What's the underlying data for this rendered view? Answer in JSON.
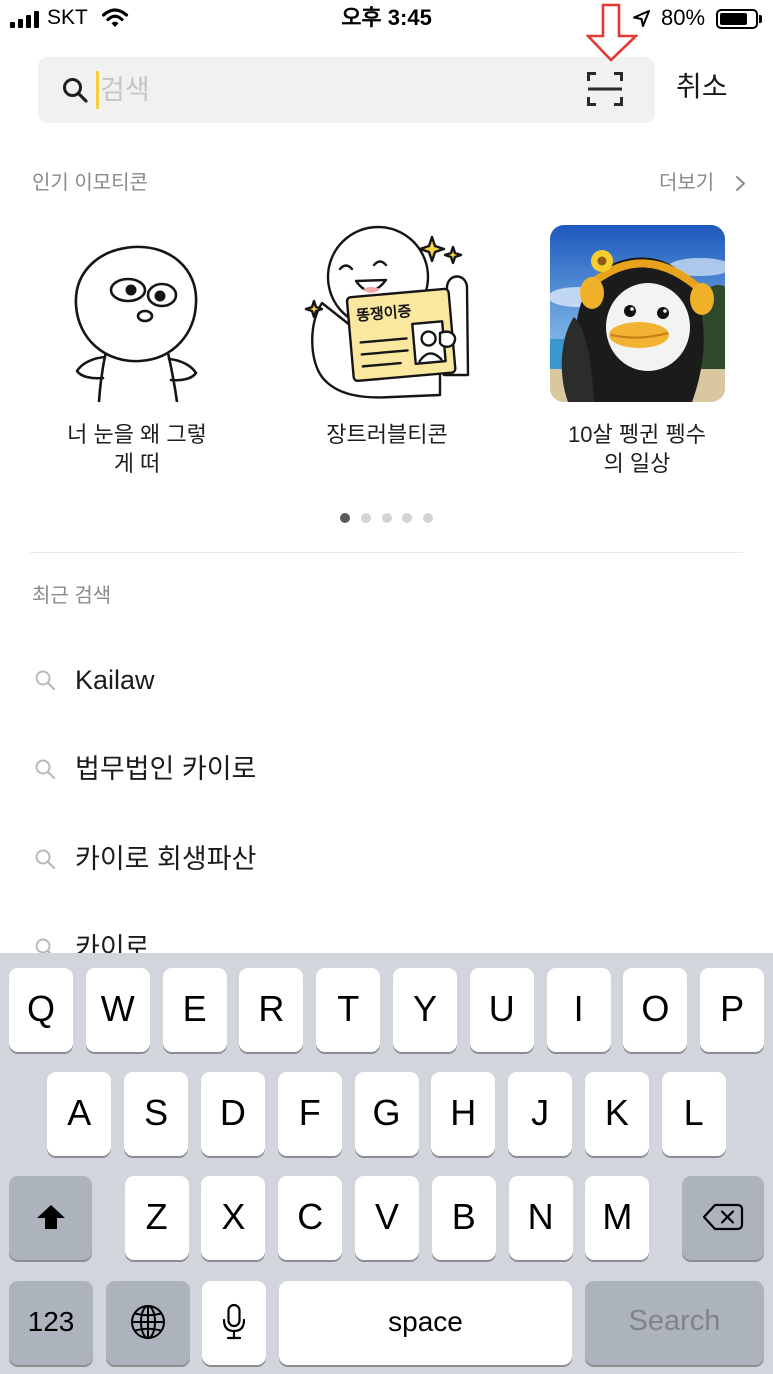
{
  "status_bar": {
    "carrier": "SKT",
    "time": "오후 3:45",
    "battery_percent": "80%",
    "battery_level": 0.8
  },
  "search": {
    "placeholder": "검색",
    "value": "",
    "cancel_label": "취소"
  },
  "popular_emoticons": {
    "title": "인기 이모티콘",
    "more_label": "더보기",
    "items": [
      {
        "title": "너 눈을 왜 그렇\n게 떠"
      },
      {
        "title": "장트러블티콘",
        "card_text": "똥쟁이증"
      },
      {
        "title": "10살 펭귄 펭수\n의 일상"
      }
    ],
    "page_count": 5,
    "active_page": 0
  },
  "recent_searches": {
    "title": "최근 검색",
    "items": [
      "Kailaw",
      "법무법인 카이로",
      "카이로 회생파산",
      "카이로"
    ]
  },
  "keyboard": {
    "rows": [
      [
        "Q",
        "W",
        "E",
        "R",
        "T",
        "Y",
        "U",
        "I",
        "O",
        "P"
      ],
      [
        "A",
        "S",
        "D",
        "F",
        "G",
        "H",
        "J",
        "K",
        "L"
      ],
      [
        "Z",
        "X",
        "C",
        "V",
        "B",
        "N",
        "M"
      ]
    ],
    "numbers_label": "123",
    "space_label": "space",
    "return_label": "Search"
  },
  "icons": {
    "search": "search-icon",
    "scan": "scan-icon",
    "more": "chevron-right-icon",
    "shift": "shift-icon",
    "delete": "delete-icon",
    "globe": "globe-icon",
    "microphone": "microphone-icon",
    "annotation": "down-arrow-annotation"
  },
  "colors": {
    "cursor": "#f5cf3a",
    "annotation_arrow": "#e33b32",
    "keyboard_background": "#d2d5db",
    "special_key": "#adb3bd",
    "secondary_text": "#8a8a8a"
  }
}
